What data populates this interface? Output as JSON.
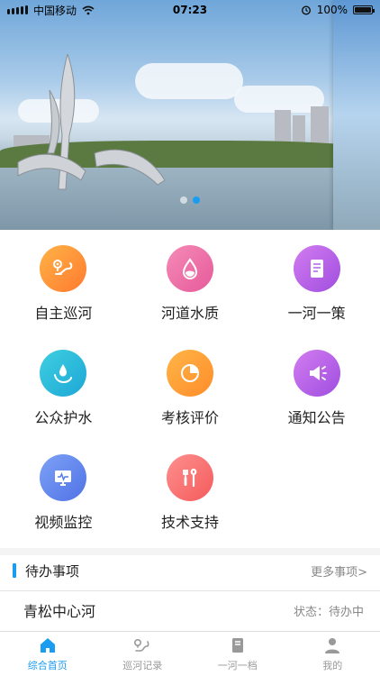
{
  "status_bar": {
    "carrier": "中国移动",
    "time": "07:23",
    "battery": "100%"
  },
  "banner": {
    "slide_count": 2,
    "active_slide": 2
  },
  "features": [
    {
      "label": "自主巡河",
      "icon": "route-icon",
      "color_from": "#ffb347",
      "color_to": "#ff7a2f"
    },
    {
      "label": "河道水质",
      "icon": "water-drop-icon",
      "color_from": "#f58bb7",
      "color_to": "#e65a9a"
    },
    {
      "label": "一河一策",
      "icon": "document-icon",
      "color_from": "#d27cf0",
      "color_to": "#a04ee0"
    },
    {
      "label": "公众护水",
      "icon": "hand-drop-icon",
      "color_from": "#3ecfe0",
      "color_to": "#1da7d6"
    },
    {
      "label": "考核评价",
      "icon": "pie-chart-icon",
      "color_from": "#ffb547",
      "color_to": "#ff8c2a"
    },
    {
      "label": "通知公告",
      "icon": "megaphone-icon",
      "color_from": "#d27cf0",
      "color_to": "#a04ee0"
    },
    {
      "label": "视频监控",
      "icon": "monitor-icon",
      "color_from": "#7da2f5",
      "color_to": "#4f72e6"
    },
    {
      "label": "技术支持",
      "icon": "tools-icon",
      "color_from": "#ff8f8f",
      "color_to": "#f35b5b"
    }
  ],
  "pending": {
    "title": "待办事项",
    "more_label": "更多事项>",
    "items": [
      {
        "name": "青松中心河",
        "status": "状态：待办中"
      }
    ]
  },
  "tabbar": {
    "accent": "#1a9cf0",
    "tabs": [
      {
        "label": "综合首页",
        "icon": "home-icon",
        "active": true
      },
      {
        "label": "巡河记录",
        "icon": "route-record-icon",
        "active": false
      },
      {
        "label": "一河一档",
        "icon": "archive-icon",
        "active": false
      },
      {
        "label": "我的",
        "icon": "user-icon",
        "active": false
      }
    ]
  }
}
